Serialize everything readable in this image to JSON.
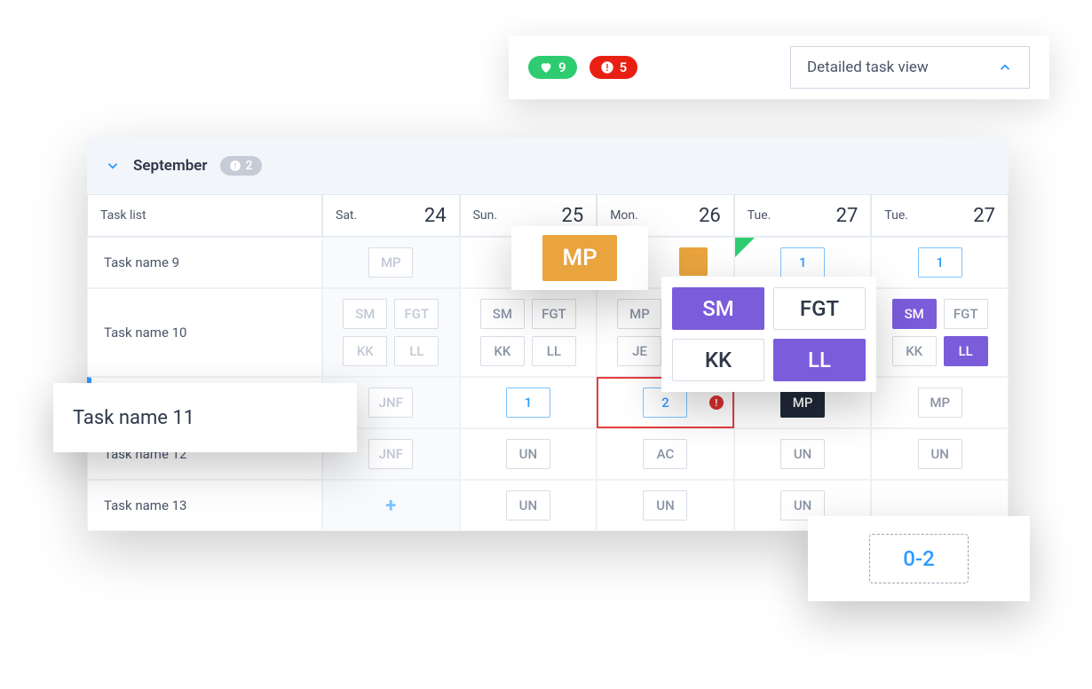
{
  "toolbar": {
    "heart_count": "9",
    "alert_count": "5",
    "view_label": "Detailed task view"
  },
  "month": {
    "label": "September",
    "badge_count": "2"
  },
  "columns": {
    "task_list": "Task list",
    "days": [
      {
        "dow": "Sat.",
        "num": "24"
      },
      {
        "dow": "Sun.",
        "num": "25"
      },
      {
        "dow": "Mon.",
        "num": "26"
      },
      {
        "dow": "Tue.",
        "num": "27"
      },
      {
        "dow": "Tue.",
        "num": "27"
      }
    ]
  },
  "rows": {
    "r0": {
      "label": "Task name 9",
      "c0": "MP",
      "c3": "1",
      "c4": "1"
    },
    "r1": {
      "label": "Task name 10",
      "c0": [
        "SM",
        "FGT",
        "KK",
        "LL"
      ],
      "c1": [
        "SM",
        "FGT",
        "KK",
        "LL"
      ],
      "c2": [
        "MP",
        "JE"
      ],
      "c4a": [
        "SM",
        "FGT"
      ],
      "c4b": [
        "KK",
        "LL"
      ]
    },
    "r2": {
      "label": "Task name 11",
      "c0": "JNF",
      "c1": "1",
      "c2": "2",
      "c3": "MP",
      "c4": "MP"
    },
    "r3": {
      "label": "Task name 12",
      "c0": "JNF",
      "c1": "UN",
      "c2": "AC",
      "c3": "UN",
      "c4": "UN"
    },
    "r4": {
      "label": "Task name 13",
      "c1": "UN",
      "c2": "UN",
      "c3": "UN"
    }
  },
  "float": {
    "mp": "MP",
    "grid": {
      "a": "SM",
      "b": "FGT",
      "c": "KK",
      "d": "LL"
    },
    "task": "Task name 11",
    "range": "0-2"
  }
}
